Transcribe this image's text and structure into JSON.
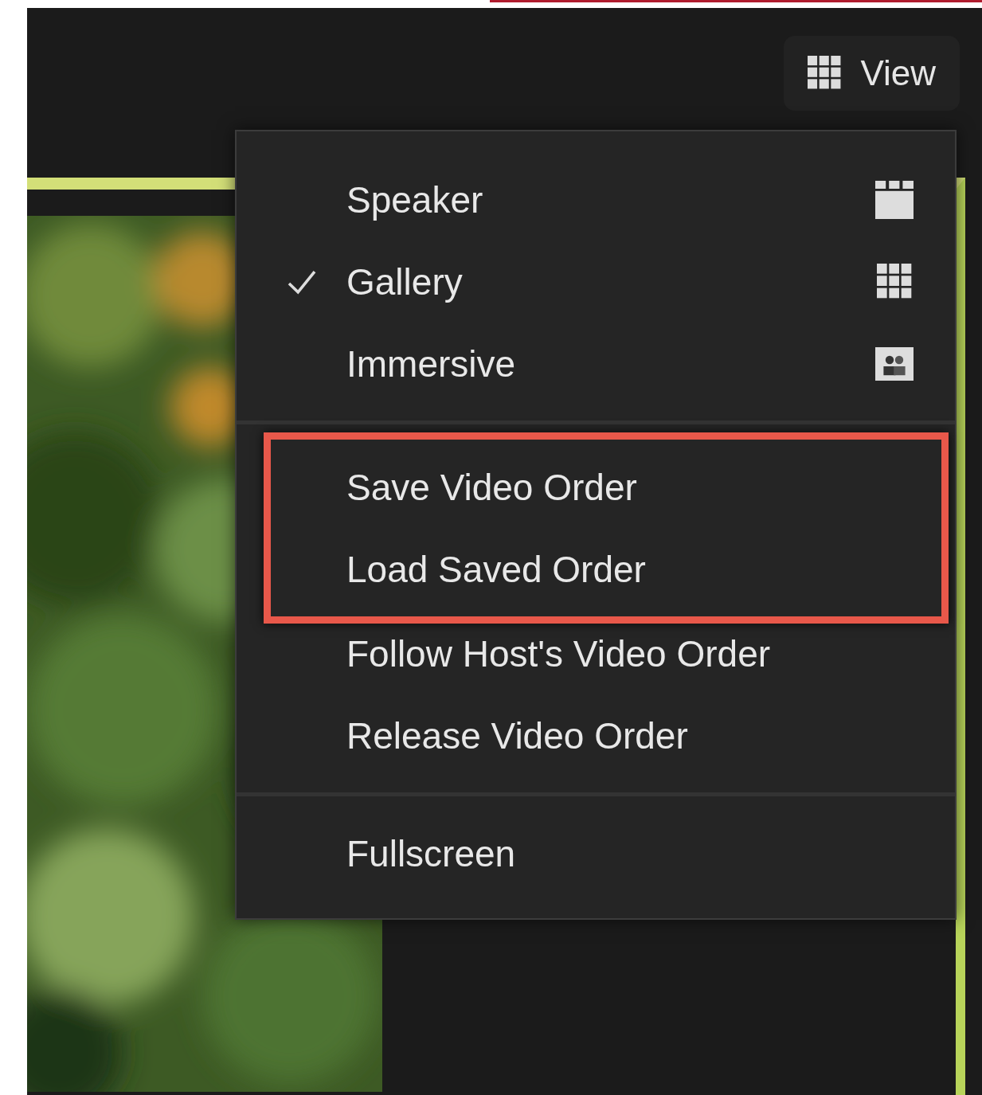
{
  "view_button": {
    "label": "View"
  },
  "menu": {
    "sections": [
      {
        "items": [
          {
            "label": "Speaker",
            "checked": false,
            "highlighted": false
          },
          {
            "label": "Gallery",
            "checked": true,
            "highlighted": false
          },
          {
            "label": "Immersive",
            "checked": false,
            "highlighted": false
          }
        ]
      },
      {
        "items": [
          {
            "label": "Save Video Order",
            "checked": false,
            "highlighted": true
          },
          {
            "label": "Load Saved Order",
            "checked": false,
            "highlighted": true
          },
          {
            "label": "Follow Host's Video Order",
            "checked": false,
            "highlighted": false
          },
          {
            "label": "Release Video Order",
            "checked": false,
            "highlighted": false
          }
        ]
      },
      {
        "items": [
          {
            "label": "Fullscreen",
            "checked": false,
            "highlighted": false
          }
        ]
      }
    ]
  },
  "video_tile": {
    "kind": "picture",
    "active": true
  }
}
